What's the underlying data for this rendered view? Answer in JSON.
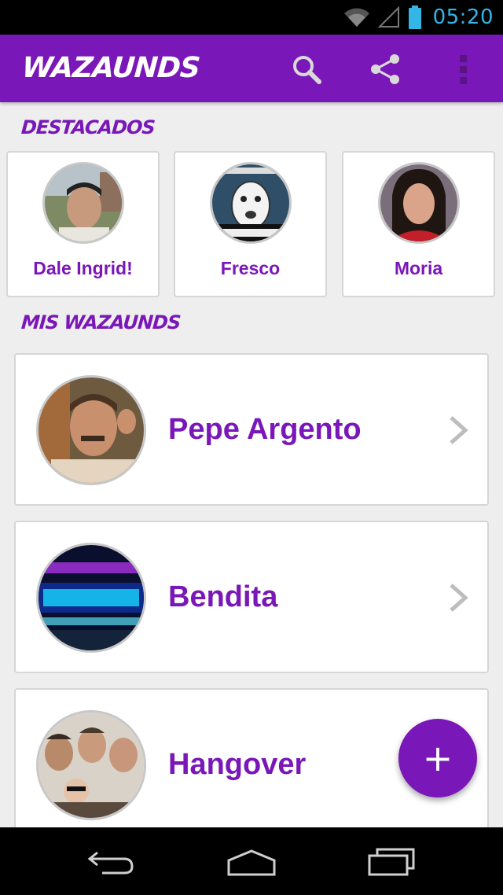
{
  "status_bar": {
    "time": "05:20",
    "icons": [
      "wifi-icon",
      "signal-icon",
      "battery-icon"
    ],
    "time_color": "#33b5e5"
  },
  "app_bar": {
    "title": "WAZAUNDS",
    "actions": [
      "search-icon",
      "share-icon",
      "overflow-menu-icon"
    ],
    "color": "#7a17b8"
  },
  "featured": {
    "title": "DESTACADOS",
    "items": [
      {
        "label": "Dale Ingrid!",
        "image": "avatar-boy-photo"
      },
      {
        "label": "Fresco",
        "image": "avatar-meme-face"
      },
      {
        "label": "Moria",
        "image": "avatar-woman-photo"
      }
    ]
  },
  "mine": {
    "title": "MIS WAZAUNDS",
    "items": [
      {
        "label": "Pepe Argento",
        "image": "avatar-man-photo",
        "icon": "chevron-right-icon"
      },
      {
        "label": "Bendita",
        "image": "avatar-tv-show-logo",
        "icon": "chevron-right-icon"
      },
      {
        "label": "Hangover",
        "image": "avatar-movie-poster",
        "icon": ""
      }
    ]
  },
  "fab": {
    "label": "+",
    "icon": "add-icon"
  },
  "nav_bar": {
    "buttons": [
      "back-icon",
      "home-icon",
      "recents-icon"
    ]
  }
}
